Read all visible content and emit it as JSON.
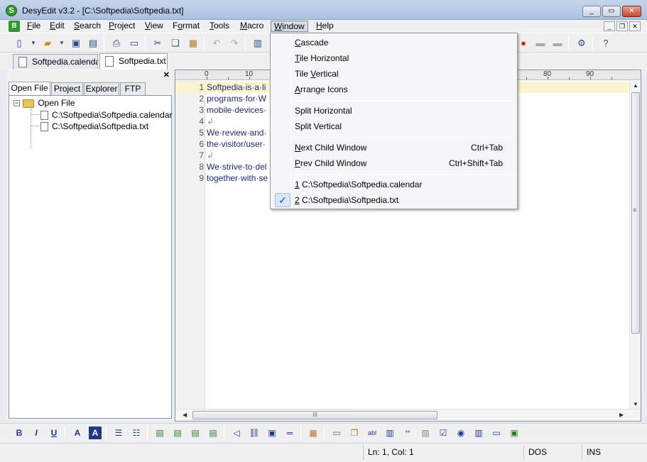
{
  "window": {
    "title": "DesyEdit v3.2 - [C:\\Softpedia\\Softpedia.txt]",
    "controls": [
      "_",
      "▭",
      "✕"
    ]
  },
  "menubar": {
    "items": [
      {
        "label": "File",
        "key": "F"
      },
      {
        "label": "Edit",
        "key": "E"
      },
      {
        "label": "Search",
        "key": "S"
      },
      {
        "label": "Project",
        "key": "P"
      },
      {
        "label": "View",
        "key": "V"
      },
      {
        "label": "Format",
        "key": "o"
      },
      {
        "label": "Tools",
        "key": "T"
      },
      {
        "label": "Macro",
        "key": "M"
      },
      {
        "label": "Window",
        "key": "W"
      },
      {
        "label": "Help",
        "key": "H"
      }
    ],
    "active": "Window"
  },
  "doc_tabs": [
    {
      "label": "Softpedia.calendar",
      "active": false
    },
    {
      "label": "Softpedia.txt",
      "active": true
    }
  ],
  "left_panel": {
    "tabs": [
      "Open File",
      "Project",
      "Explorer",
      "FTP"
    ],
    "active_tab": "Open File",
    "tree": {
      "root": "Open File",
      "children": [
        "C:\\Softpedia\\Softpedia.calendar",
        "C:\\Softpedia\\Softpedia.txt"
      ]
    }
  },
  "editor": {
    "ruler": [
      "0",
      "10",
      "80",
      "90"
    ],
    "lines": [
      {
        "num": "1",
        "text": "Softpedia·is·a·li"
      },
      {
        "num": "2",
        "text": "programs·for·W"
      },
      {
        "num": "3",
        "text": "mobile·devices·"
      },
      {
        "num": "4",
        "text": "↲"
      },
      {
        "num": "5",
        "text": "We·review·and·"
      },
      {
        "num": "6",
        "text": "the·visitor/user·"
      },
      {
        "num": "7",
        "text": "↲"
      },
      {
        "num": "8",
        "text": "We·strive·to·del"
      },
      {
        "num": "9",
        "text": "together·with·se"
      }
    ],
    "scroll_thumb_text": "III",
    "vscroll_thumb_text": "≡"
  },
  "window_menu": {
    "groups": [
      [
        {
          "label": "Cascade",
          "key": "C",
          "shortcut": ""
        },
        {
          "label": "Tile Horizontal",
          "key": "T",
          "shortcut": ""
        },
        {
          "label": "Tile Vertical",
          "key": "V",
          "shortcut": ""
        },
        {
          "label": "Arrange Icons",
          "key": "A",
          "shortcut": ""
        }
      ],
      [
        {
          "label": "Split Horizontal",
          "key": "",
          "shortcut": ""
        },
        {
          "label": "Split Vertical",
          "key": "",
          "shortcut": ""
        }
      ],
      [
        {
          "label": "Next Child Window",
          "key": "N",
          "shortcut": "Ctrl+Tab"
        },
        {
          "label": "Prev Child Window",
          "key": "P",
          "shortcut": "Ctrl+Shift+Tab"
        }
      ],
      [
        {
          "label": "1 C:\\Softpedia\\Softpedia.calendar",
          "key": "1",
          "shortcut": "",
          "checked": false
        },
        {
          "label": "2 C:\\Softpedia\\Softpedia.txt",
          "key": "2",
          "shortcut": "",
          "checked": true
        }
      ]
    ]
  },
  "statusbar": {
    "position": "Ln: 1, Col: 1",
    "eol": "DOS",
    "mode": "INS"
  },
  "colors": {
    "title_bar": "#b7cbe6",
    "current_line": "#fbf5cf",
    "text": "#1e2a78",
    "app_icon": "#2a9b2a"
  }
}
